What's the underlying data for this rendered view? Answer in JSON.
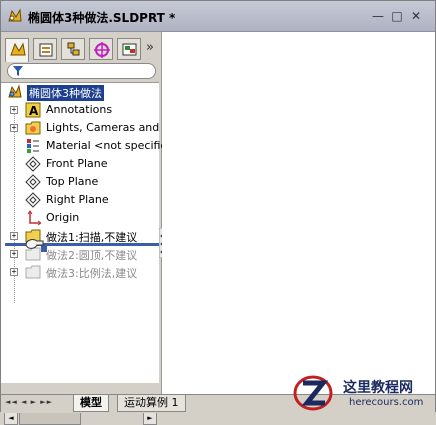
{
  "window": {
    "title": "椭圆体3种做法.SLDPRT *",
    "controls": [
      "—",
      "□",
      "✕"
    ]
  },
  "panel_tabs": [
    {
      "name": "feature-manager",
      "active": true
    },
    {
      "name": "property-manager",
      "active": false
    },
    {
      "name": "configuration-manager",
      "active": false
    },
    {
      "name": "dimxpert-manager",
      "active": false
    },
    {
      "name": "display-manager",
      "active": false
    }
  ],
  "panel_tabs_more": "»",
  "tree": {
    "root": "椭圆体3种做法",
    "items": [
      {
        "label": "Annotations",
        "icon": "annotations-icon",
        "expander": "+",
        "dim": false
      },
      {
        "label": "Lights, Cameras and Sc",
        "icon": "lights-folder-icon",
        "expander": "+",
        "dim": false
      },
      {
        "label": "Material <not specified",
        "icon": "material-icon",
        "expander": "",
        "dim": false
      },
      {
        "label": "Front Plane",
        "icon": "plane-icon",
        "expander": "",
        "dim": false
      },
      {
        "label": "Top Plane",
        "icon": "plane-icon",
        "expander": "",
        "dim": false
      },
      {
        "label": "Right Plane",
        "icon": "plane-icon",
        "expander": "",
        "dim": false
      },
      {
        "label": "Origin",
        "icon": "origin-icon",
        "expander": "",
        "dim": false
      },
      {
        "label": "做法1:扫描,不建议",
        "icon": "folder-icon",
        "expander": "+",
        "dim": false
      },
      {
        "label": "做法2:圆顶,不建议",
        "icon": "folder-icon",
        "expander": "+",
        "dim": true
      },
      {
        "label": "做法3:比例法,建议",
        "icon": "folder-icon",
        "expander": "+",
        "dim": true
      }
    ]
  },
  "bottom_tabs": [
    {
      "label": "模型",
      "active": true
    },
    {
      "label": "运动算例 1",
      "active": false
    }
  ],
  "nav_arrows": "◄◄ ◄ ► ►►",
  "watermark": {
    "title": "这里教程网",
    "url": "herecours.com"
  },
  "colors": {
    "selection": "#1e3f8f",
    "rollback_bar": "#3a5ea8",
    "panel_bg": "#d4d0c8"
  }
}
